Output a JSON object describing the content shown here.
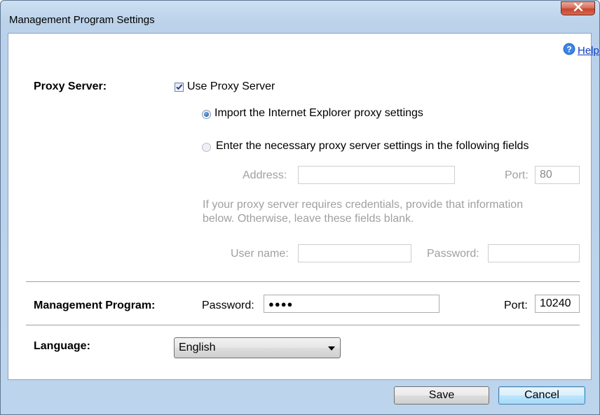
{
  "window": {
    "title": "Management Program Settings",
    "close_label": "x"
  },
  "help": {
    "label": "Help"
  },
  "proxy": {
    "section_label": "Proxy Server:",
    "use_proxy_label": "Use Proxy Server",
    "use_proxy_checked": true,
    "import_ie_label": "Import the Internet Explorer proxy settings",
    "manual_label": "Enter the necessary proxy server settings in the following fields",
    "selected_option": "import_ie",
    "address_label": "Address:",
    "address_value": "",
    "port_label": "Port:",
    "port_value": "80",
    "credentials_note_line1": "If your proxy server requires credentials, provide that information",
    "credentials_note_line2": "below.  Otherwise, leave these fields blank.",
    "username_label": "User name:",
    "username_value": "",
    "password_label": "Password:",
    "password_value": ""
  },
  "management": {
    "section_label": "Management Program:",
    "password_label": "Password:",
    "password_value": "●●●●",
    "port_label": "Port:",
    "port_value": "10240"
  },
  "language": {
    "section_label": "Language:",
    "selected": "English"
  },
  "buttons": {
    "save": "Save",
    "cancel": "Cancel"
  },
  "colors": {
    "link": "#0a3cc4",
    "disabled_text": "#a0a0a0",
    "titlebar": "#bcd3ea",
    "close_button": "#c8452c"
  }
}
